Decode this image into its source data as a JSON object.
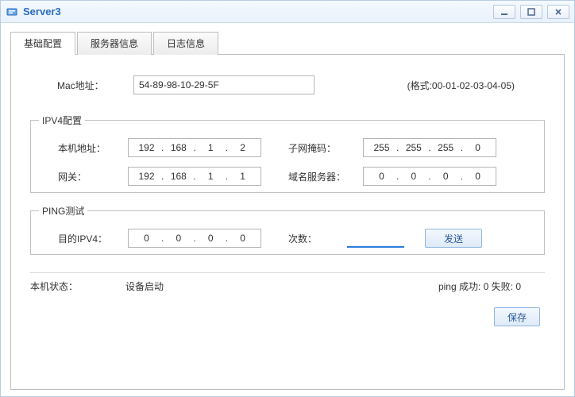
{
  "window": {
    "title": "Server3"
  },
  "tabs": {
    "items": [
      {
        "label": "基础配置"
      },
      {
        "label": "服务器信息"
      },
      {
        "label": "日志信息"
      }
    ]
  },
  "mac": {
    "label": "Mac地址：",
    "value": "54-89-98-10-29-5F",
    "hint": "(格式:00-01-02-03-04-05)"
  },
  "ipv4": {
    "legend": "IPV4配置",
    "host_label": "本机地址：",
    "host": [
      "192",
      "168",
      "1",
      "2"
    ],
    "mask_label": "子网掩码：",
    "mask": [
      "255",
      "255",
      "255",
      "0"
    ],
    "gw_label": "网关：",
    "gw": [
      "192",
      "168",
      "1",
      "1"
    ],
    "dns_label": "域名服务器：",
    "dns": [
      "0",
      "0",
      "0",
      "0"
    ]
  },
  "ping": {
    "legend": "PING测试",
    "target_label": "目的IPV4：",
    "target": [
      "0",
      "0",
      "0",
      "0"
    ],
    "count_label": "次数：",
    "count": "",
    "send_label": "发送"
  },
  "status": {
    "host_state_label": "本机状态：",
    "host_state_value": "设备启动",
    "ping_result": "ping 成功: 0 失败: 0"
  },
  "footer": {
    "save_label": "保存"
  }
}
